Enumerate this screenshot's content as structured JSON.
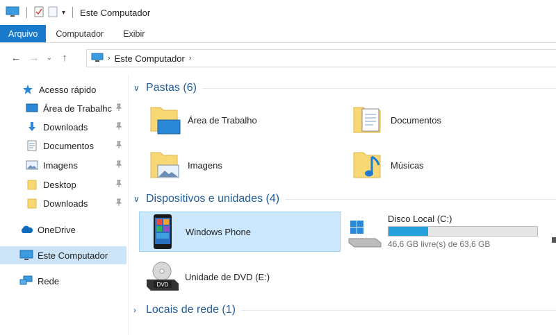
{
  "window": {
    "title": "Este Computador"
  },
  "ribbon": {
    "tabs": [
      "Arquivo",
      "Computador",
      "Exibir"
    ]
  },
  "address": {
    "crumbs": [
      "Este Computador"
    ]
  },
  "sidebar": {
    "items": [
      {
        "label": "Acesso rápido",
        "icon": "star-icon"
      },
      {
        "label": "Área de Trabalhc",
        "icon": "desktop-icon",
        "pinned": true
      },
      {
        "label": "Downloads",
        "icon": "download-icon",
        "pinned": true
      },
      {
        "label": "Documentos",
        "icon": "documents-icon",
        "pinned": true
      },
      {
        "label": "Imagens",
        "icon": "pictures-icon",
        "pinned": true
      },
      {
        "label": "Desktop",
        "icon": "folder-icon",
        "pinned": true
      },
      {
        "label": "Downloads",
        "icon": "folder-icon",
        "pinned": true
      },
      {
        "label": "OneDrive",
        "icon": "cloud-icon"
      },
      {
        "label": "Este Computador",
        "icon": "computer-icon",
        "selected": true
      },
      {
        "label": "Rede",
        "icon": "network-icon"
      }
    ]
  },
  "main": {
    "folders_group": "Pastas (6)",
    "folders": [
      {
        "label": "Área de Trabalho",
        "icon": "desktop-folder-icon"
      },
      {
        "label": "Documentos",
        "icon": "documents-folder-icon"
      },
      {
        "label": "Imagens",
        "icon": "pictures-folder-icon"
      },
      {
        "label": "Músicas",
        "icon": "music-folder-icon"
      }
    ],
    "devices_group": "Dispositivos e unidades (4)",
    "devices": [
      {
        "label": "Windows Phone",
        "icon": "phone-icon",
        "selected": true
      },
      {
        "label": "Unidade de DVD (E:)",
        "icon": "dvd-drive-icon"
      }
    ],
    "drive": {
      "label": "Disco Local (C:)",
      "free_text": "46,6 GB livre(s) de 63,6 GB",
      "used_fraction": 0.267,
      "bar_color": "#26a0da"
    },
    "network_group": "Locais de rede (1)"
  },
  "colors": {
    "accent": "#1979ca",
    "group_title": "#1e5c9c",
    "selection": "#cce8ff"
  }
}
